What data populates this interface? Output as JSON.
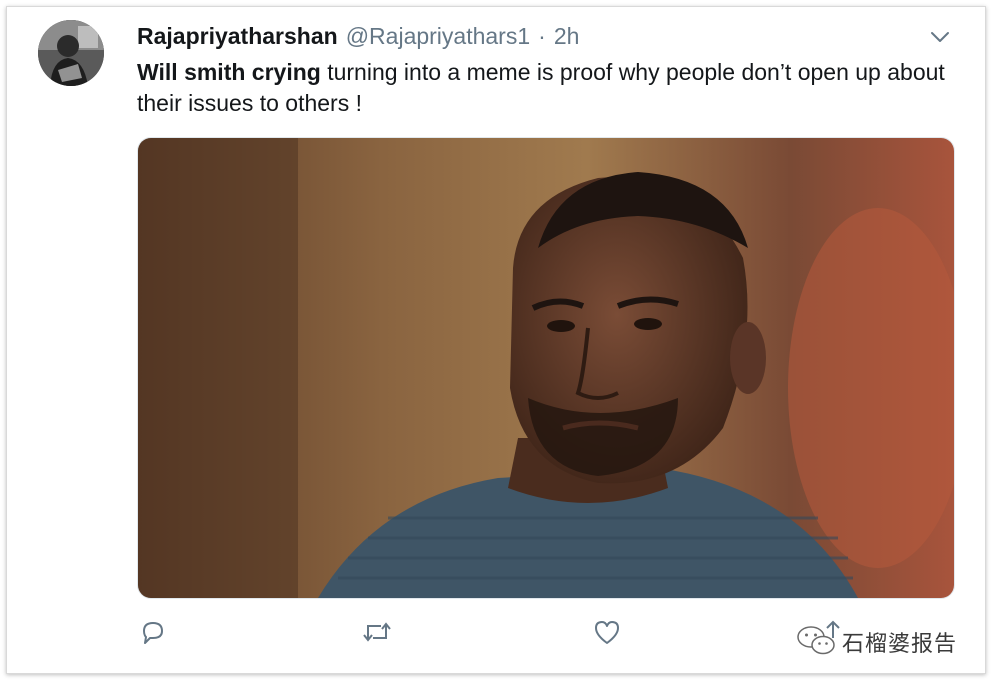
{
  "tweet": {
    "author_name": "Rajapriyatharshan",
    "author_handle": "@Rajapriyathars1",
    "separator": "·",
    "time": "2h",
    "text_bold": "Will smith crying",
    "text_rest": " turning into a meme is proof why people don’t open up about their issues to others !"
  },
  "icons": {
    "menu": "chevron-down-icon",
    "reply": "reply-icon",
    "retweet": "retweet-icon",
    "like": "heart-icon",
    "share": "share-icon"
  },
  "watermark": {
    "text": "石榴婆报告"
  },
  "colors": {
    "text_primary": "#14171a",
    "text_secondary": "#657786",
    "icon": "#657786"
  }
}
